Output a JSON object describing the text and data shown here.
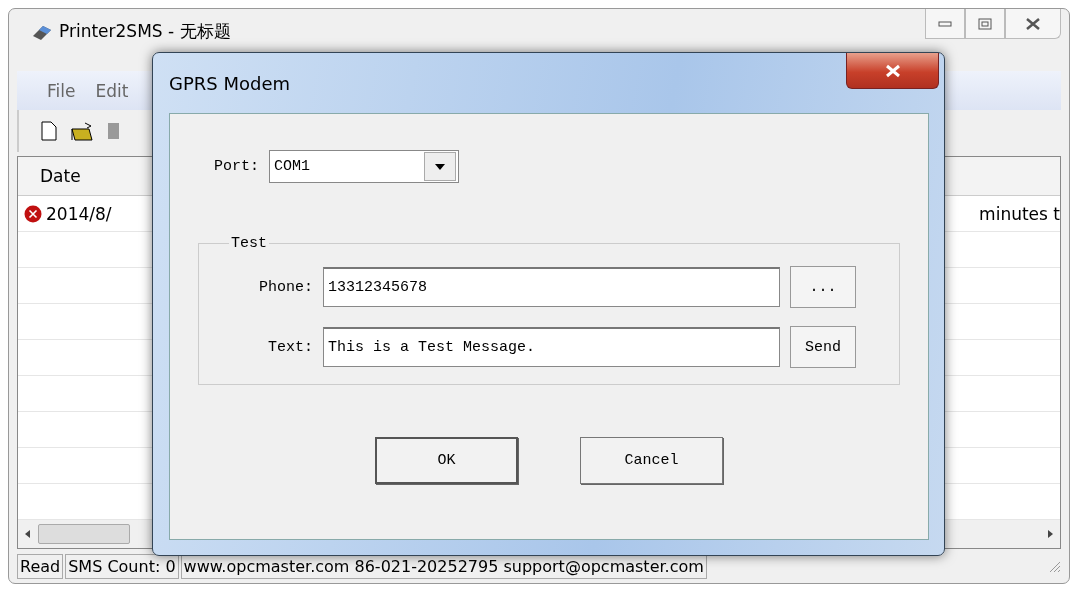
{
  "window": {
    "title": "Printer2SMS - 无标题"
  },
  "menu": [
    "File",
    "Edit"
  ],
  "table": {
    "columns": [
      "Date"
    ],
    "rows": [
      {
        "date": "2014/8/",
        "column_2": "minutes t"
      }
    ]
  },
  "status_bar": [
    "Read",
    "SMS Count: 0",
    "www.opcmaster.com 86-021-20252795 support@opcmaster.com"
  ],
  "dialog": {
    "title": "GPRS Modem",
    "port_label": "Port:",
    "port_value": "COM1",
    "group_title": "Test",
    "phone_label": "Phone:",
    "phone_value": "13312345678",
    "browse_button": "...",
    "text_label": "Text:",
    "text_value": "This is a Test Message.",
    "send_button": "Send",
    "buttons": [
      "OK",
      "Cancel"
    ]
  }
}
